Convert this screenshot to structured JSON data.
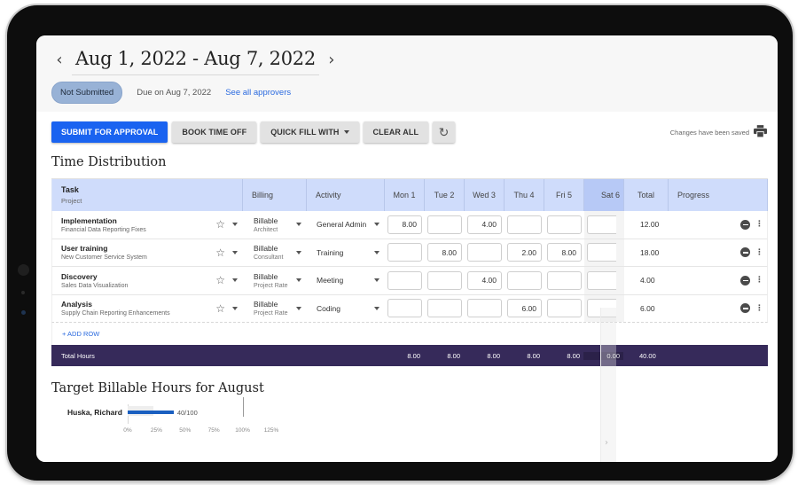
{
  "header": {
    "date_range": "Aug 1, 2022 - Aug 7, 2022",
    "prev_icon": "chevron-left-icon",
    "next_icon": "chevron-right-icon",
    "status_badge": "Not Submitted",
    "due_text": "Due on Aug 7, 2022",
    "approvers_link": "See all approvers"
  },
  "toolbar": {
    "submit_label": "SUBMIT FOR APPROVAL",
    "book_time_off_label": "BOOK TIME OFF",
    "quick_fill_label": "QUICK FILL WITH",
    "clear_all_label": "CLEAR ALL",
    "refresh_icon": "refresh-icon",
    "saved_status": "Changes have been saved",
    "print_icon": "print-icon"
  },
  "time_distribution": {
    "title": "Time Distribution",
    "columns": {
      "task": "Task",
      "project": "Project",
      "billing": "Billing",
      "activity": "Activity",
      "days": [
        "Mon 1",
        "Tue 2",
        "Wed 3",
        "Thu 4",
        "Fri 5",
        "Sat 6"
      ],
      "total": "Total",
      "progress": "Progress"
    },
    "rows": [
      {
        "task": "Implementation",
        "project": "Financial Data Reporting Fixes",
        "billing": "Billable",
        "rate": "Architect",
        "activity": "General Admin",
        "hours": [
          "8.00",
          "",
          "4.00",
          "",
          "",
          ""
        ],
        "total": "12.00"
      },
      {
        "task": "User training",
        "project": "New Customer Service System",
        "billing": "Billable",
        "rate": "Consultant",
        "activity": "Training",
        "hours": [
          "",
          "8.00",
          "",
          "2.00",
          "8.00",
          ""
        ],
        "total": "18.00"
      },
      {
        "task": "Discovery",
        "project": "Sales Data Visualization",
        "billing": "Billable",
        "rate": "Project Rate",
        "activity": "Meeting",
        "hours": [
          "",
          "",
          "4.00",
          "",
          "",
          ""
        ],
        "total": "4.00"
      },
      {
        "task": "Analysis",
        "project": "Supply Chain Reporting Enhancements",
        "billing": "Billable",
        "rate": "Project Rate",
        "activity": "Coding",
        "hours": [
          "",
          "",
          "",
          "6.00",
          "",
          ""
        ],
        "total": "6.00"
      }
    ],
    "add_row_label": "+ ADD ROW",
    "totals": {
      "label": "Total Hours",
      "days": [
        "8.00",
        "8.00",
        "8.00",
        "8.00",
        "8.00",
        "0.00"
      ],
      "total": "40.00"
    }
  },
  "target_billable": {
    "title": "Target Billable Hours for August",
    "person": "Huska, Richard",
    "value_label": "40/100",
    "progress_fraction": 0.4,
    "ticks": [
      "0%",
      "25%",
      "50%",
      "75%",
      "100%",
      "125%"
    ]
  }
}
